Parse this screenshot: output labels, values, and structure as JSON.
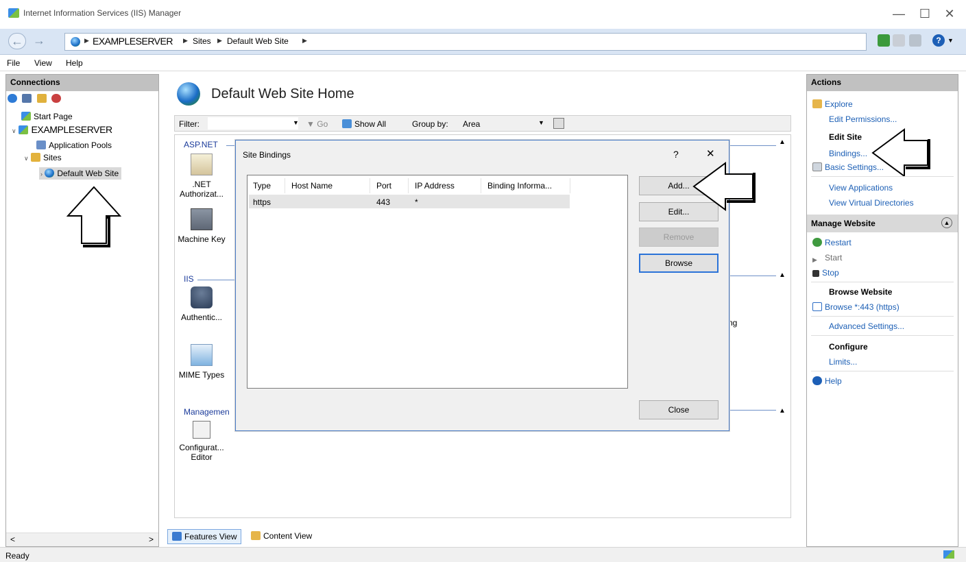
{
  "window": {
    "title": "Internet Information Services (IIS) Manager",
    "min_glyph": "—",
    "max_glyph": "☐",
    "close_glyph": "✕"
  },
  "address": {
    "crumbs": [
      "EXAMPLESERVER",
      "Sites",
      "Default Web Site"
    ],
    "separator": "▶"
  },
  "menu": [
    "File",
    "View",
    "Help"
  ],
  "connections": {
    "header": "Connections",
    "tree": {
      "start_page": "Start Page",
      "server": "EXAMPLESERVER",
      "app_pools": "Application Pools",
      "sites": "Sites",
      "default_site": "Default Web Site"
    },
    "scroll_left": "<",
    "scroll_right": ">"
  },
  "main": {
    "title": "Default Web Site Home",
    "filter": {
      "label": "Filter:",
      "go": "Go",
      "show_all": "Show All",
      "group_by_label": "Group by:",
      "group_by_value": "Area"
    },
    "sections": {
      "aspnet": "ASP.NET",
      "iis": "IIS",
      "management": "Managemen"
    },
    "features": {
      "net_auth": [
        ".NET",
        "Authorizat..."
      ],
      "machine_key": "Machine Key",
      "authentication": "Authentic...",
      "mime_types": "MIME Types",
      "config_editor": [
        "Configurat...",
        "Editor"
      ]
    },
    "partial_text": "ng",
    "view_tabs": {
      "features": "Features View",
      "content": "Content View"
    }
  },
  "dialog": {
    "title": "Site Bindings",
    "help_glyph": "?",
    "close_glyph": "✕",
    "columns": [
      "Type",
      "Host Name",
      "Port",
      "IP Address",
      "Binding Informa..."
    ],
    "rows": [
      {
        "type": "https",
        "host": "",
        "port": "443",
        "ip": "*",
        "info": ""
      }
    ],
    "buttons": {
      "add": "Add...",
      "edit": "Edit...",
      "remove": "Remove",
      "browse": "Browse",
      "close": "Close"
    }
  },
  "actions": {
    "header": "Actions",
    "explore": "Explore",
    "edit_permissions": "Edit Permissions...",
    "edit_site": "Edit Site",
    "bindings": "Bindings...",
    "basic_settings": "Basic Settings...",
    "view_apps": "View Applications",
    "view_vdirs": "View Virtual Directories",
    "manage_website": "Manage Website",
    "restart": "Restart",
    "start": "Start",
    "stop": "Stop",
    "browse_website": "Browse Website",
    "browse_443": "Browse *:443 (https)",
    "advanced_settings": "Advanced Settings...",
    "configure": "Configure",
    "limits": "Limits...",
    "help": "Help"
  },
  "status": {
    "text": "Ready"
  },
  "colors": {
    "link": "#1c5fb5",
    "section": "#1a3a9a",
    "pane_header": "#c1c1c1",
    "address_bg": "#d9e5f4"
  }
}
